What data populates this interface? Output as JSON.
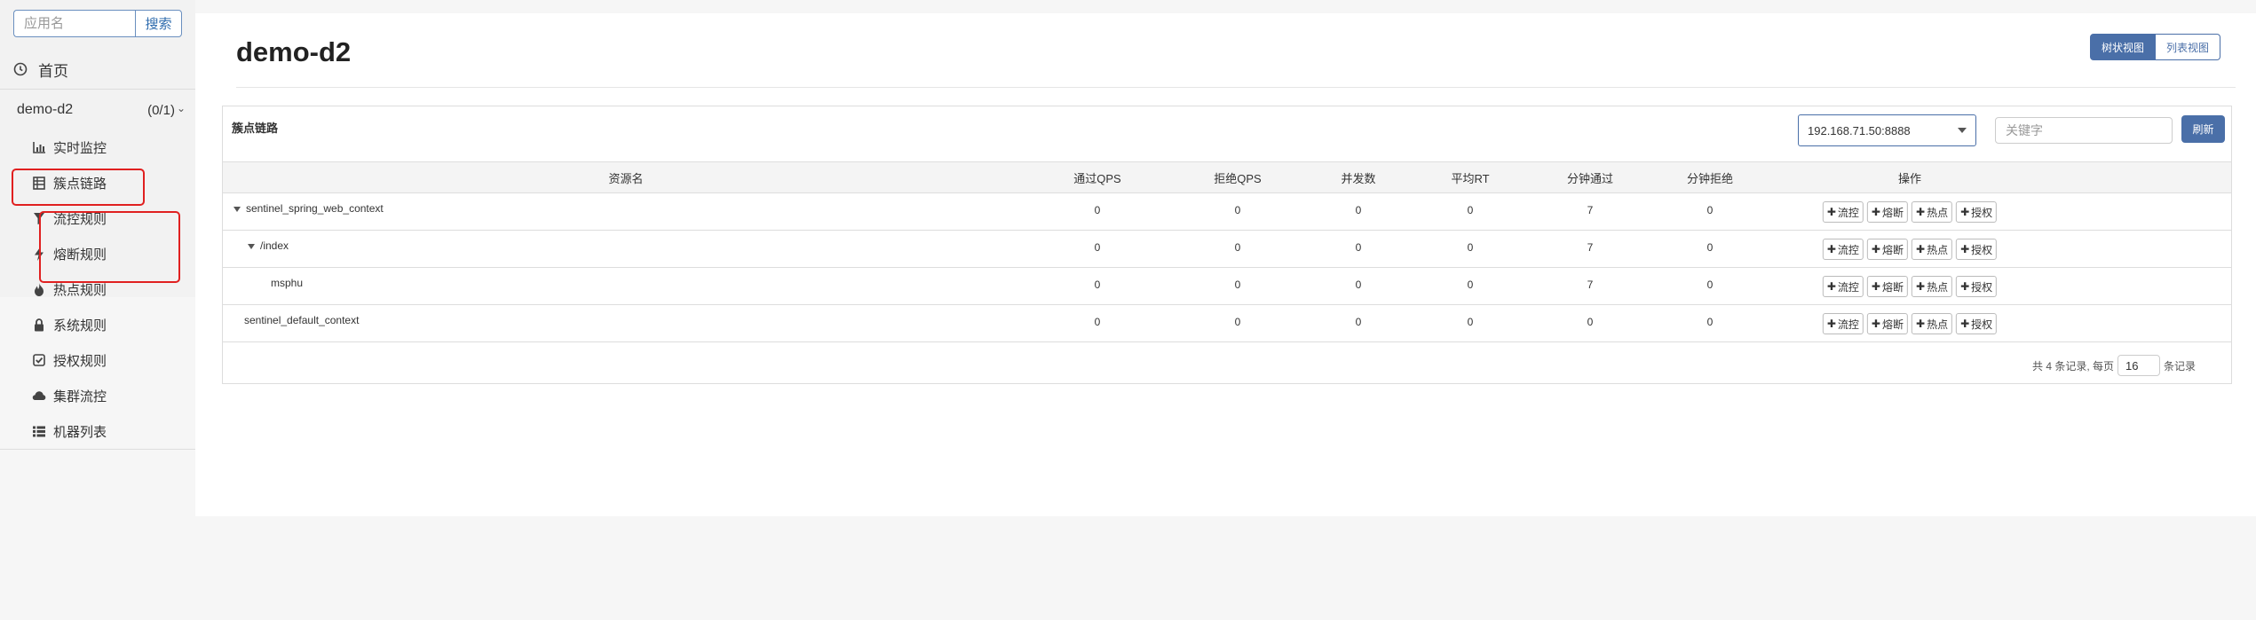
{
  "sidebar": {
    "search": {
      "placeholder": "应用名",
      "button": "搜索"
    },
    "home": "首页",
    "app": {
      "name": "demo-d2",
      "count": "(0/1)"
    },
    "items": [
      {
        "label": "实时监控",
        "icon": "bar-chart-icon"
      },
      {
        "label": "簇点链路",
        "icon": "list-table-icon"
      },
      {
        "label": "流控规则",
        "icon": "filter-icon"
      },
      {
        "label": "熔断规则",
        "icon": "bolt-icon"
      },
      {
        "label": "热点规则",
        "icon": "fire-icon"
      },
      {
        "label": "系统规则",
        "icon": "lock-icon"
      },
      {
        "label": "授权规则",
        "icon": "check-square-icon"
      },
      {
        "label": "集群流控",
        "icon": "cloud-icon"
      },
      {
        "label": "机器列表",
        "icon": "list-icon"
      }
    ]
  },
  "header": {
    "title": "demo-d2",
    "views": {
      "tree": "树状视图",
      "list": "列表视图"
    }
  },
  "panel": {
    "title": "簇点链路",
    "machine": "192.168.71.50:8888",
    "keyword_placeholder": "关键字",
    "refresh": "刷新"
  },
  "table": {
    "columns": [
      "资源名",
      "通过QPS",
      "拒绝QPS",
      "并发数",
      "平均RT",
      "分钟通过",
      "分钟拒绝",
      "操作"
    ],
    "rows": [
      {
        "resource": "sentinel_spring_web_context",
        "pass_qps": "0",
        "block_qps": "0",
        "threads": "0",
        "avg_rt": "0",
        "min_pass": "7",
        "min_block": "0"
      },
      {
        "resource": "/index",
        "pass_qps": "0",
        "block_qps": "0",
        "threads": "0",
        "avg_rt": "0",
        "min_pass": "7",
        "min_block": "0"
      },
      {
        "resource": "msphu",
        "pass_qps": "0",
        "block_qps": "0",
        "threads": "0",
        "avg_rt": "0",
        "min_pass": "7",
        "min_block": "0"
      },
      {
        "resource": "sentinel_default_context",
        "pass_qps": "0",
        "block_qps": "0",
        "threads": "0",
        "avg_rt": "0",
        "min_pass": "0",
        "min_block": "0"
      }
    ],
    "actions": [
      "流控",
      "熔断",
      "热点",
      "授权"
    ]
  },
  "pager": {
    "prefix": "共 4 条记录, 每页",
    "page_size": "16",
    "suffix": "条记录"
  },
  "colors": {
    "accent": "#4a6fa8",
    "highlight": "#e02020"
  }
}
